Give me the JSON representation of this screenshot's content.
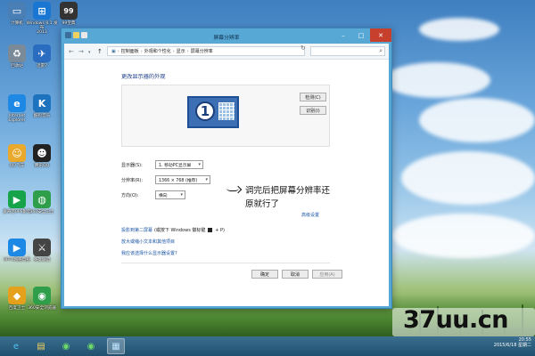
{
  "desktop": {
    "icons": [
      {
        "label": "计算机",
        "icon": "computer-icon",
        "color": "#4a7fb5"
      },
      {
        "label": "Windows 8.1 发布\n2013",
        "icon": "windows-logo-icon",
        "color": "#1976d2"
      },
      {
        "label": "99宝典",
        "icon": "app-99-icon",
        "color": "#333333"
      },
      {
        "label": "回收站",
        "icon": "recycle-bin-icon",
        "color": "#7a8a99"
      },
      {
        "label": "迅雷7",
        "icon": "thunder-icon",
        "color": "#2a6cc0"
      },
      {
        "label": "Internet\nExplorer",
        "icon": "internet-explorer-icon",
        "color": "#1e88e5"
      },
      {
        "label": "酷狗音乐",
        "icon": "kugou-icon",
        "color": "#1e73be"
      },
      {
        "label": "QQ飞车",
        "icon": "qq-speed-icon",
        "color": "#e8a92c"
      },
      {
        "label": "腾讯QQ",
        "icon": "qq-icon",
        "color": "#222222"
      },
      {
        "label": "爱奇艺PPS影音",
        "icon": "pps-icon",
        "color": "#16a34a"
      },
      {
        "label": "360安全卫士",
        "icon": "360-icon",
        "color": "#2e9e4a"
      },
      {
        "label": "PPTV网络电视",
        "icon": "pptv-icon",
        "color": "#1e88e5"
      },
      {
        "label": "英雄联盟",
        "icon": "lol-icon",
        "color": "#444444"
      },
      {
        "label": "百度卫士",
        "icon": "baidu-guard-icon",
        "color": "#e6a11c"
      },
      {
        "label": "360安全浏览器",
        "icon": "360-browser-icon",
        "color": "#2e9e4a"
      }
    ]
  },
  "window": {
    "title": "屏幕分辨率",
    "breadcrumb": [
      "控制面板",
      "外观和个性化",
      "显示",
      "屏幕分辨率"
    ],
    "heading": "更改显示器的外观",
    "monitor_number": "1",
    "detect_label": "检测(C)",
    "identify_label": "识别(I)",
    "display_label": "显示器(S):",
    "display_value": "1. 移动PC显示屏",
    "resolution_label": "分辨率(R):",
    "resolution_value": "1366 × 768 (推荐)",
    "orientation_label": "方向(O):",
    "orientation_value": "横向",
    "advanced_link": "高级设置",
    "project_link": "投影到第二屏幕",
    "project_hint_a": "(或按下 Windows 徽标键",
    "project_hint_b": "+ P)",
    "text_size_link": "放大或缩小文本和其他项目",
    "which_display_link": "我应该选择什么显示器设置?",
    "ok_label": "确定",
    "cancel_label": "取消",
    "apply_label": "应用(A)"
  },
  "annotation": {
    "line1": "调完后把屏幕分辨率还",
    "line2": "原就行了"
  },
  "taskbar": {
    "time": "20:55",
    "date": "2015/6/18 星期二"
  },
  "watermark": {
    "text": "37uu.cn"
  }
}
